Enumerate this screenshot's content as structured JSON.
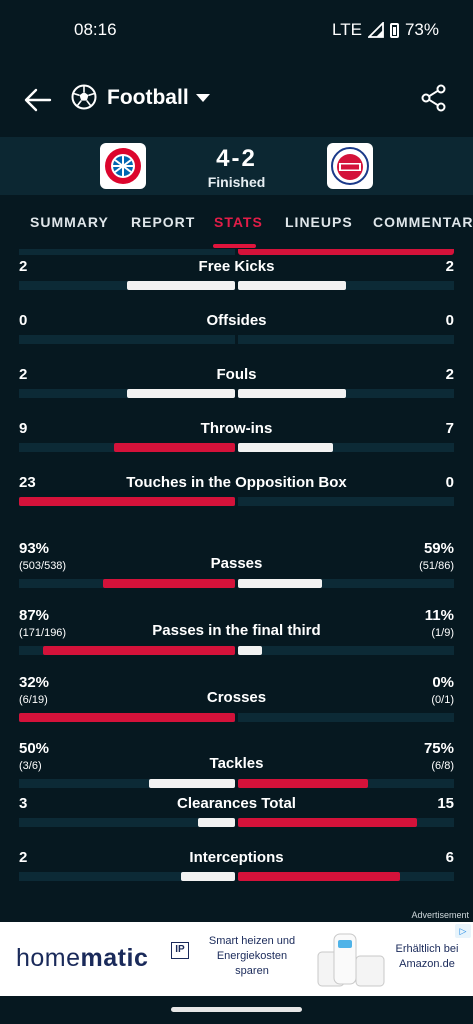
{
  "status_bar": {
    "time": "08:16",
    "network": "LTE",
    "battery": "73%"
  },
  "app_bar": {
    "title": "Football"
  },
  "match": {
    "score": "4-2",
    "status": "Finished"
  },
  "tabs": [
    {
      "label": "SUMMARY",
      "active": false
    },
    {
      "label": "REPORT",
      "active": false
    },
    {
      "label": "STATS",
      "active": true
    },
    {
      "label": "LINEUPS",
      "active": false
    },
    {
      "label": "COMMENTARY",
      "active": false
    }
  ],
  "stats": [
    {
      "label": "Free Kicks",
      "home": "2",
      "away": "2",
      "home_share": 0.5,
      "away_share": 0.5,
      "home_color": "white",
      "away_color": "white"
    },
    {
      "label": "Offsides",
      "home": "0",
      "away": "0",
      "home_share": 0,
      "away_share": 0,
      "home_color": "white",
      "away_color": "white"
    },
    {
      "label": "Fouls",
      "home": "2",
      "away": "2",
      "home_share": 0.5,
      "away_share": 0.5,
      "home_color": "white",
      "away_color": "white"
    },
    {
      "label": "Throw-ins",
      "home": "9",
      "away": "7",
      "home_share": 0.56,
      "away_share": 0.44,
      "home_color": "red",
      "away_color": "white"
    },
    {
      "label": "Touches in the Opposition Box",
      "home": "23",
      "away": "0",
      "home_share": 1.0,
      "away_share": 0,
      "home_color": "red",
      "away_color": "white"
    },
    {
      "label": "Passes",
      "home": "93%",
      "away": "59%",
      "home_sub": "(503/538)",
      "away_sub": "(51/86)",
      "home_share": 0.61,
      "away_share": 0.39,
      "home_color": "red",
      "away_color": "white"
    },
    {
      "label": "Passes in the final third",
      "home": "87%",
      "away": "11%",
      "home_sub": "(171/196)",
      "away_sub": "(1/9)",
      "home_share": 0.89,
      "away_share": 0.11,
      "home_color": "red",
      "away_color": "white"
    },
    {
      "label": "Crosses",
      "home": "32%",
      "away": "0%",
      "home_sub": "(6/19)",
      "away_sub": "(0/1)",
      "home_share": 1.0,
      "away_share": 0,
      "home_color": "red",
      "away_color": "white"
    },
    {
      "label": "Tackles",
      "home": "50%",
      "away": "75%",
      "home_sub": "(3/6)",
      "away_sub": "(6/8)",
      "home_share": 0.4,
      "away_share": 0.6,
      "home_color": "white",
      "away_color": "red"
    },
    {
      "label": "Clearances Total",
      "home": "3",
      "away": "15",
      "home_share": 0.17,
      "away_share": 0.83,
      "home_color": "white",
      "away_color": "red"
    },
    {
      "label": "Interceptions",
      "home": "2",
      "away": "6",
      "home_share": 0.25,
      "away_share": 0.75,
      "home_color": "white",
      "away_color": "red"
    }
  ],
  "ad": {
    "label": "Advertisement",
    "brand_light": "home",
    "brand_bold": "matic",
    "brand_ip": "IP",
    "pitch": "Smart heizen und Energiekosten sparen",
    "availability": "Erhältlich bei Amazon.de"
  },
  "colors": {
    "accent": "#e0143c",
    "background": "#061820",
    "bar_track": "#0c2a36"
  }
}
